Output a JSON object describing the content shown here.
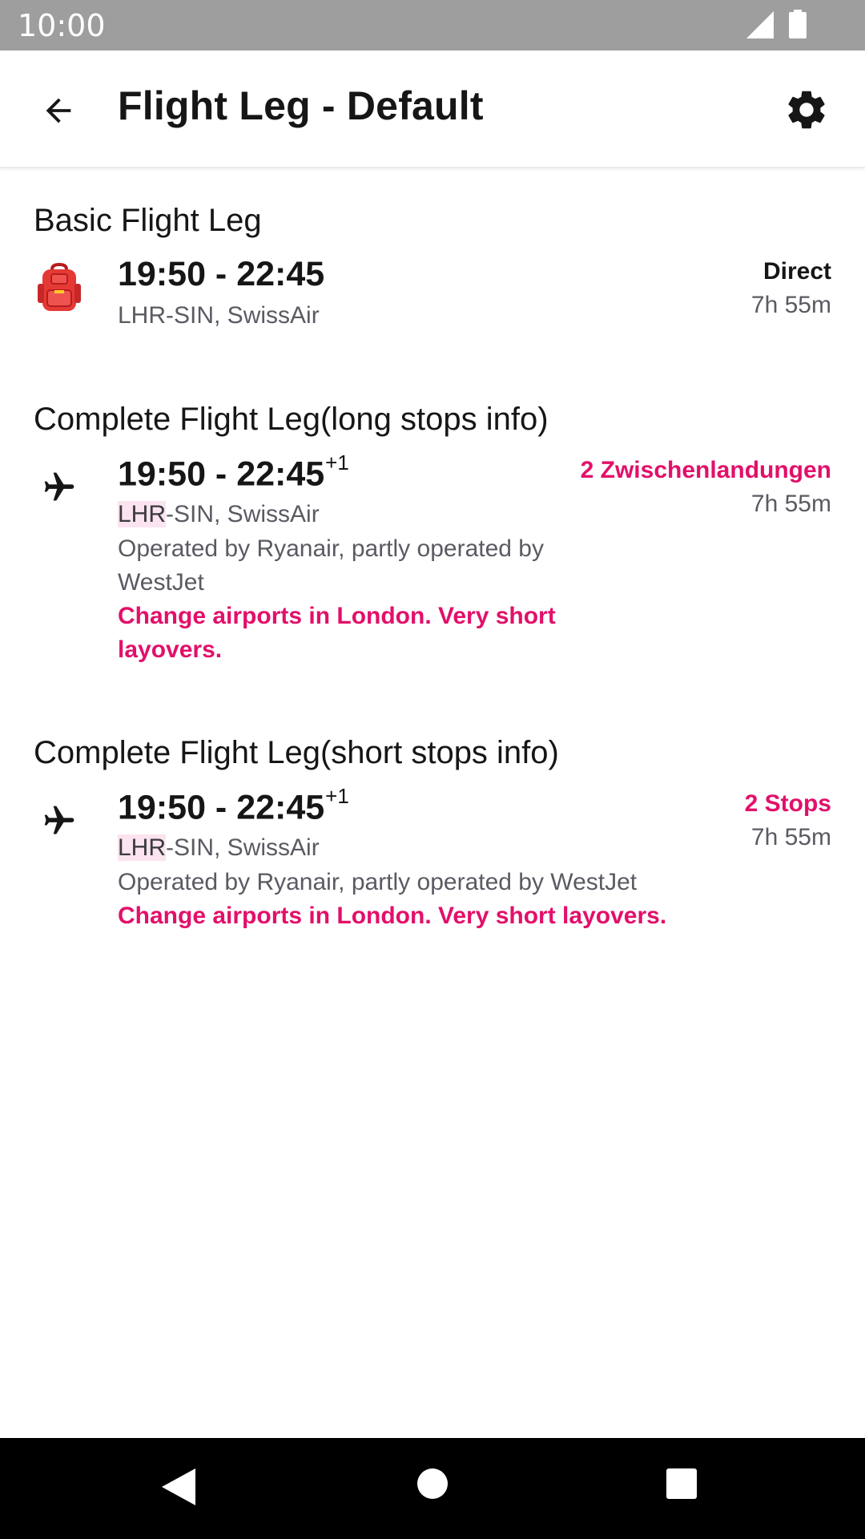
{
  "status_bar": {
    "time": "10:00",
    "icons": [
      "signal-icon",
      "battery-icon"
    ]
  },
  "app_bar": {
    "title": "Flight Leg - Default",
    "back_icon": "arrow-back-icon",
    "settings_icon": "gear-icon"
  },
  "sections": [
    {
      "heading": "Basic Flight Leg",
      "icon": "backpack-icon",
      "times": "19:50 - 22:45",
      "day_offset": "",
      "route_highlight": "",
      "route": "LHR-SIN, SwissAir",
      "operated_by": "",
      "warning": "",
      "stops": "Direct",
      "duration": "7h 55m"
    },
    {
      "heading": "Complete Flight Leg(long stops info)",
      "icon": "airplane-icon",
      "times": "19:50 - 22:45",
      "day_offset": "+1",
      "route_highlight": "LHR",
      "route": "-SIN, SwissAir",
      "operated_by": "Operated by Ryanair, partly operated by WestJet",
      "warning": "Change airports in London. Very short layovers.",
      "stops": "2 Zwischenlandungen",
      "duration": "7h 55m"
    },
    {
      "heading": "Complete Flight Leg(short stops info)",
      "icon": "airplane-icon",
      "times": "19:50 - 22:45",
      "day_offset": "+1",
      "route_highlight": "LHR",
      "route": "-SIN, SwissAir",
      "operated_by": "Operated by Ryanair, partly operated by WestJet",
      "warning": "Change airports in London. Very short layovers.",
      "stops": "2 Stops",
      "duration": "7h 55m"
    }
  ],
  "colors": {
    "accent": "#e2106a",
    "highlight": "#fbe3ef",
    "secondary_text": "#5a5a63",
    "status_bar": "#9e9e9e"
  },
  "nav_bar": {
    "icons": [
      "nav-back-icon",
      "nav-home-icon",
      "nav-recents-icon"
    ]
  }
}
